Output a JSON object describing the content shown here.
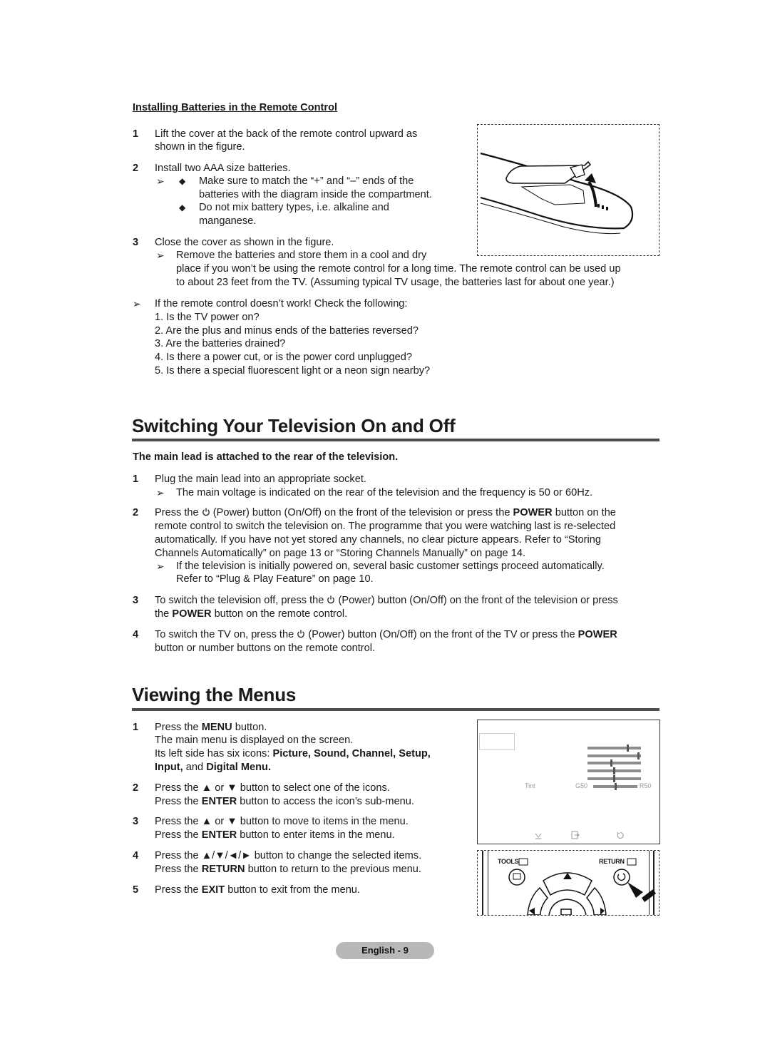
{
  "battery_section": {
    "heading": "Installing Batteries in the Remote Control",
    "step1_num": "1",
    "step1_line1": "Lift the cover at the back of the remote control upward as",
    "step1_line2": "shown in the figure.",
    "step2_num": "2",
    "step2_text": "Install two AAA size batteries.",
    "bullet1_line1": "Make sure to match the “+” and “–” ends of the",
    "bullet1_line2": "batteries with the diagram inside the compartment.",
    "bullet2_line1": "Do not mix battery types, i.e. alkaline and",
    "bullet2_line2": "manganese.",
    "step3_num": "3",
    "step3_text": "Close the cover as shown in the figure.",
    "note_line1": "Remove the batteries and store them in a cool and dry",
    "note_line2": "place if you won’t be using the remote control for a long time. The remote control can be used up",
    "note_line3": "to about 23 feet from the TV. (Assuming typical TV usage, the batteries last for about one year.)",
    "check_intro": "If the remote control doesn’t work! Check the following:",
    "checks": [
      "1. Is the TV power on?",
      "2. Are the plus and minus ends of the batteries reversed?",
      "3. Are the batteries drained?",
      "4. Is there a power cut, or is the power cord unplugged?",
      "5. Is there a special fluorescent light or a neon sign nearby?"
    ]
  },
  "switching_section": {
    "title": "Switching Your Television On and Off",
    "subheading": "The main lead is attached to the rear of the television.",
    "s1_num": "1",
    "s1_text": "Plug the main lead into an appropriate socket.",
    "s1_note": "The main voltage is indicated on the rear of the television and the frequency is 50 or 60Hz.",
    "s2_num": "2",
    "s2_a": "Press the",
    "s2_b": "(Power) button (On/Off) on the front of the television or press the",
    "s2_bold": "POWER",
    "s2_c": "button on the",
    "s2_line2": "remote control to switch the television on. The programme that you were watching last is re-selected",
    "s2_line3": "automatically. If you have not yet stored any channels, no clear picture appears. Refer to “Storing",
    "s2_line4": "Channels Automatically” on page 13 or “Storing Channels Manually” on page 14.",
    "s2_note1": "If the television is initially powered on, several basic customer settings proceed automatically.",
    "s2_note2": "Refer to “Plug & Play Feature” on page 10.",
    "s3_num": "3",
    "s3_a": "To switch the television off, press the",
    "s3_b": "(Power) button (On/Off) on the front of the television or press",
    "s3_c": "the",
    "s3_bold": "POWER",
    "s3_d": "button on the remote control.",
    "s4_num": "4",
    "s4_a": "To switch the TV on, press the",
    "s4_b": "(Power) button (On/Off) on the front of the TV or press the",
    "s4_bold": "POWER",
    "s4_line2": "button or number buttons on the remote control."
  },
  "menus_section": {
    "title": "Viewing the Menus",
    "m1_num": "1",
    "m1_a": "Press the",
    "m1_bold": "MENU",
    "m1_b": "button.",
    "m1_line2": "The main menu is displayed on the screen.",
    "m1_line3a": "Its left side has six icons:",
    "m1_line3b": "Picture, Sound, Channel, Setup,",
    "m1_line4a": "Input,",
    "m1_line4b": "and",
    "m1_line4c": "Digital Menu.",
    "m2_num": "2",
    "m2_line1": "Press the ▲ or ▼ button to select one of the icons.",
    "m2_line2a": "Press the",
    "m2_line2b": "ENTER",
    "m2_line2c": "button to access the icon’s sub-menu.",
    "m3_num": "3",
    "m3_line1": "Press the ▲ or ▼ button to move to items in the menu.",
    "m3_line2a": "Press the",
    "m3_line2b": "ENTER",
    "m3_line2c": "button to enter items in the menu.",
    "m4_num": "4",
    "m4_line1": "Press the ▲/▼/◄/► button to change the selected items.",
    "m4_line2a": "Press the",
    "m4_line2b": "RETURN",
    "m4_line2c": "button to return to the previous menu.",
    "m5_num": "5",
    "m5_a": "Press the",
    "m5_bold": "EXIT",
    "m5_b": "button to exit from the menu."
  },
  "tv_menu_figure": {
    "tint_label": "Tint",
    "left_label": "G50",
    "right_label": "R50",
    "slider_levels": [
      0.77,
      0.97,
      0.45,
      0.5,
      0.5,
      0.5
    ],
    "footer_icons": [
      "move-icon",
      "enter-icon",
      "return-icon"
    ]
  },
  "remote_figure": {
    "tools_label": "TOOLS",
    "return_label": "RETURN"
  },
  "footer": {
    "page_label": "English - 9"
  }
}
